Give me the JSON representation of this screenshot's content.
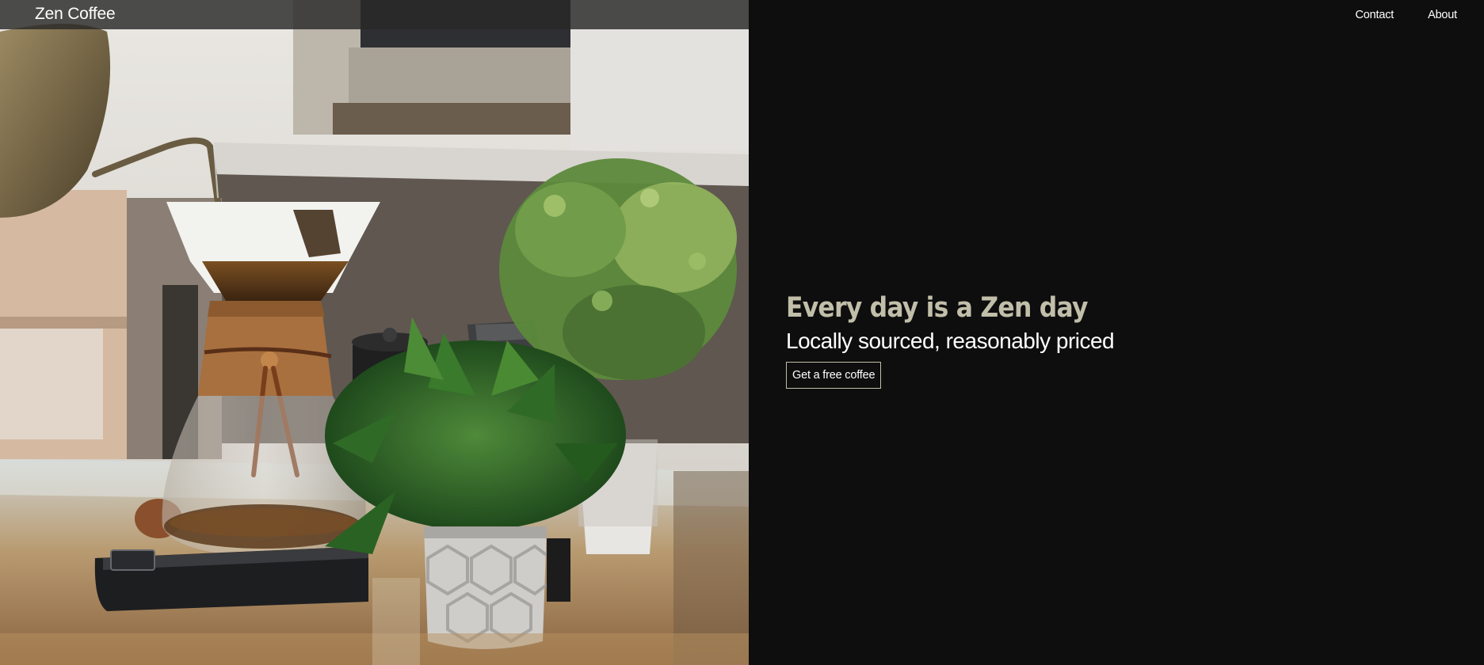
{
  "colors": {
    "background": "#0e0e0e",
    "accent": "#c1bea9",
    "text": "#ffffff",
    "nav_overlay": "#282828"
  },
  "navbar": {
    "brand": "Zen Coffee",
    "links": [
      {
        "label": "Contact"
      },
      {
        "label": "About"
      }
    ]
  },
  "hero": {
    "image_subject": "Chemex pour-over coffee with potted plants on a table",
    "title": "Every day is a Zen day",
    "subtitle": "Locally sourced, reasonably priced",
    "cta_label": "Get a free coffee"
  }
}
